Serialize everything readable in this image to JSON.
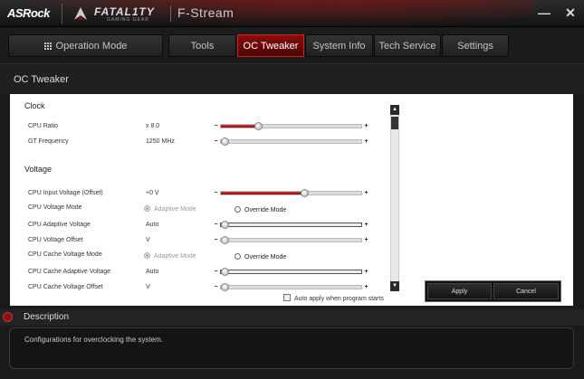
{
  "titlebar": {
    "brand": "ASRock",
    "fatal_text": "FATAL1TY",
    "gaming_text": "GAMING  GEAR",
    "app_title": "F-Stream",
    "minimize_label": "—",
    "close_label": "✕"
  },
  "tabs": {
    "operation_mode": "Operation Mode",
    "items": [
      "Tools",
      "OC Tweaker",
      "System Info",
      "Tech Service",
      "Settings"
    ],
    "active": "OC Tweaker"
  },
  "page": {
    "title": "OC Tweaker"
  },
  "clock": {
    "section_label": "Clock",
    "cpu_ratio": {
      "label": "CPU Ratio",
      "value": "x 8.0",
      "level": 0.25
    },
    "gt_frequency": {
      "label": "GT Frequency",
      "value": "1250 MHz",
      "level": 0.0
    }
  },
  "voltage": {
    "section_label": "Voltage",
    "cpu_input": {
      "label": "CPU Input Voltage (Offset)",
      "value": "+0 V",
      "level": 0.6
    },
    "cpu_mode": {
      "label": "CPU Voltage Mode",
      "option_adaptive": "Adaptive Mode",
      "option_override": "Override Mode"
    },
    "cpu_adaptive": {
      "label": "CPU Adaptive Voltage",
      "value": "Auto",
      "level": 0.0
    },
    "cpu_offset": {
      "label": "CPU Voltage Offset",
      "value": "V",
      "level": 0.0
    },
    "cache_mode": {
      "label": "CPU Cache Voltage Mode",
      "option_adaptive": "Adaptive Mode",
      "option_override": "Override Mode"
    },
    "cache_adaptive": {
      "label": "CPU Cache Adaptive Voltage",
      "value": "Auto",
      "level": 0.0
    },
    "cache_offset": {
      "label": "CPU Cache Voltage Offset",
      "value": "V",
      "level": 0.0
    }
  },
  "slider_controls": {
    "minus": "−",
    "plus": "+"
  },
  "auto_apply_label": "Auto apply when program starts",
  "buttons": {
    "apply": "Apply",
    "cancel": "Cancel"
  },
  "description": {
    "title": "Description",
    "text": "Configurations for overclocking the system."
  },
  "colors": {
    "accent": "#8a0d0d",
    "slider_fill": "#c42a2a"
  }
}
